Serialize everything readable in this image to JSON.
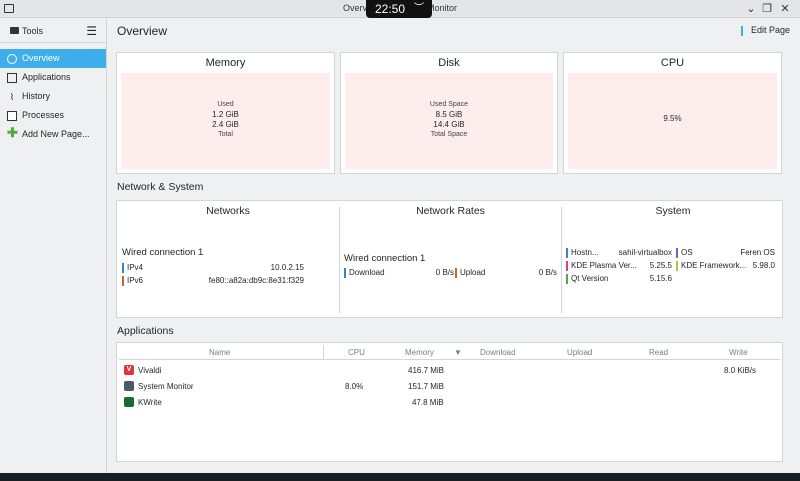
{
  "window": {
    "title": "Overview — System Monitor",
    "clock": "22:50"
  },
  "sidebar": {
    "header": "Tools",
    "items": [
      {
        "label": "Overview",
        "icon": "overview-icon",
        "active": true
      },
      {
        "label": "Applications",
        "icon": "applications-icon"
      },
      {
        "label": "History",
        "icon": "history-icon"
      },
      {
        "label": "Processes",
        "icon": "processes-icon"
      },
      {
        "label": "Add New Page...",
        "icon": "add-icon"
      }
    ]
  },
  "header": {
    "title": "Overview",
    "edit": "Edit Page"
  },
  "summary": {
    "memory": {
      "title": "Memory",
      "top": "Used",
      "used": "1.2 GiB",
      "total": "2.4 GiB",
      "bottom": "Total"
    },
    "disk": {
      "title": "Disk",
      "top": "Used Space",
      "used": "8.5 GiB",
      "total": "14.4 GiB",
      "bottom": "Total Space"
    },
    "cpu": {
      "title": "CPU",
      "value": "9.5%"
    }
  },
  "network_system": {
    "label": "Network & System",
    "networks": {
      "title": "Networks",
      "connection": "Wired connection 1",
      "rows": [
        {
          "key": "IPv4",
          "value": "10.0.2.15"
        },
        {
          "key": "IPv6",
          "value": "fe80::a82a:db9c:8e31:f329"
        }
      ]
    },
    "rates": {
      "title": "Network Rates",
      "connection": "Wired connection 1",
      "download_label": "Download",
      "download": "0 B/s",
      "upload_label": "Upload",
      "upload": "0 B/s"
    },
    "system": {
      "title": "System",
      "left": [
        {
          "key": "Hostn...",
          "value": "sahil-virtualbox"
        },
        {
          "key": "KDE Plasma Ver...",
          "value": "5.25.5"
        },
        {
          "key": "Qt Version",
          "value": "5.15.6"
        }
      ],
      "right": [
        {
          "key": "OS",
          "value": "Feren OS"
        },
        {
          "key": "KDE Framework...",
          "value": "5.98.0"
        }
      ]
    }
  },
  "applications": {
    "label": "Applications",
    "columns": [
      "Name",
      "CPU",
      "Memory",
      "Download",
      "Upload",
      "Read",
      "Write"
    ],
    "sort_indicator": "▼",
    "rows": [
      {
        "name": "Vivaldi",
        "cpu": "",
        "memory": "416.7 MiB",
        "write": "8.0 KiB/s"
      },
      {
        "name": "System Monitor",
        "cpu": "8.0%",
        "memory": "151.7 MiB",
        "write": ""
      },
      {
        "name": "KWrite",
        "cpu": "",
        "memory": "47.8 MiB",
        "write": ""
      }
    ]
  },
  "colors": {
    "accent": "#3daee9",
    "card_fill": "#fdeeed",
    "ipv4_mark": "#3d7fc1",
    "ipv6_mark": "#c8623a"
  }
}
